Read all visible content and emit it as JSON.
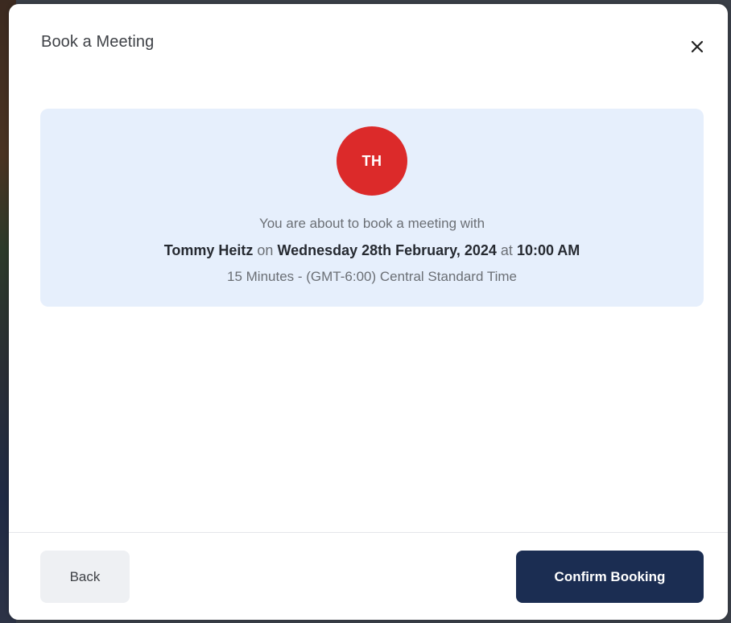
{
  "modal": {
    "title": "Book a Meeting",
    "close_icon": "close-icon"
  },
  "booking": {
    "avatar_initials": "TH",
    "avatar_color": "#dc2a2a",
    "intro": "You are about to book a meeting with",
    "host_name": "Tommy Heitz",
    "on_word": "on",
    "date": "Wednesday 28th February, 2024",
    "at_word": "at",
    "time": "10:00 AM",
    "details": "15 Minutes - (GMT-6:00) Central Standard Time",
    "card_color": "#e6effc"
  },
  "footer": {
    "back_label": "Back",
    "confirm_label": "Confirm Booking",
    "confirm_color": "#1b2d52"
  }
}
